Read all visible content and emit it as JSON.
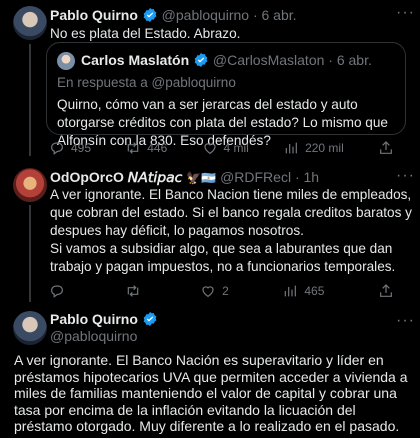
{
  "tweet1": {
    "name": "Pablo Quirno",
    "handle": "@pabloquirno",
    "date": "· 6 abr.",
    "text": "No es plata del Estado. Abrazo.",
    "quote": {
      "name": "Carlos Maslatón",
      "handle": "@CarlosMaslaton · 6 abr.",
      "reply_to": "En respuesta a @pabloquirno",
      "text": "Quirno, cómo van a ser jerarcas del estado y auto otorgarse créditos con plata del estado? Lo mismo que Alfonsín con la 830. Eso defendés?"
    },
    "stats": {
      "replies": "495",
      "retweets": "446",
      "likes": "4 mil",
      "views": "220 mil"
    }
  },
  "tweet2": {
    "name": "OdOpOrcO 𝘕𝘈𝘵𝘪𝘱𝘢𝘤",
    "emoji": "🦅🇦🇷",
    "handle": "@RDFRecl · 1h",
    "text1": "A ver ignorante. El Banco Nacion tiene miles de empleados, que cobran del estado. Si el banco regala creditos baratos y despues hay déficit, lo pagamos nosotros.",
    "text2": "Si vamos a subsidiar algo, que sea a laburantes que dan trabajo y pagan impuestos, no a funcionarios temporales.",
    "stats": {
      "replies": "",
      "retweets": "",
      "likes": "2",
      "views": "465"
    }
  },
  "tweet3": {
    "name": "Pablo Quirno",
    "handle": "@pabloquirno",
    "text": "A ver ignorante. El Banco Nación es superavitario y líder en préstamos hipotecarios UVA que permiten acceder a vivienda a miles de familias manteniendo el valor de capital y cobrar una tasa por encima de la inflación evitando la licuación del préstamo otorgado. Muy diferente a lo realizado en el pasado."
  },
  "colors": {
    "background": "#000000",
    "text": "#e7e9ea",
    "muted": "#71767b",
    "verified": "#1d9bf0",
    "border": "#2f3336"
  }
}
